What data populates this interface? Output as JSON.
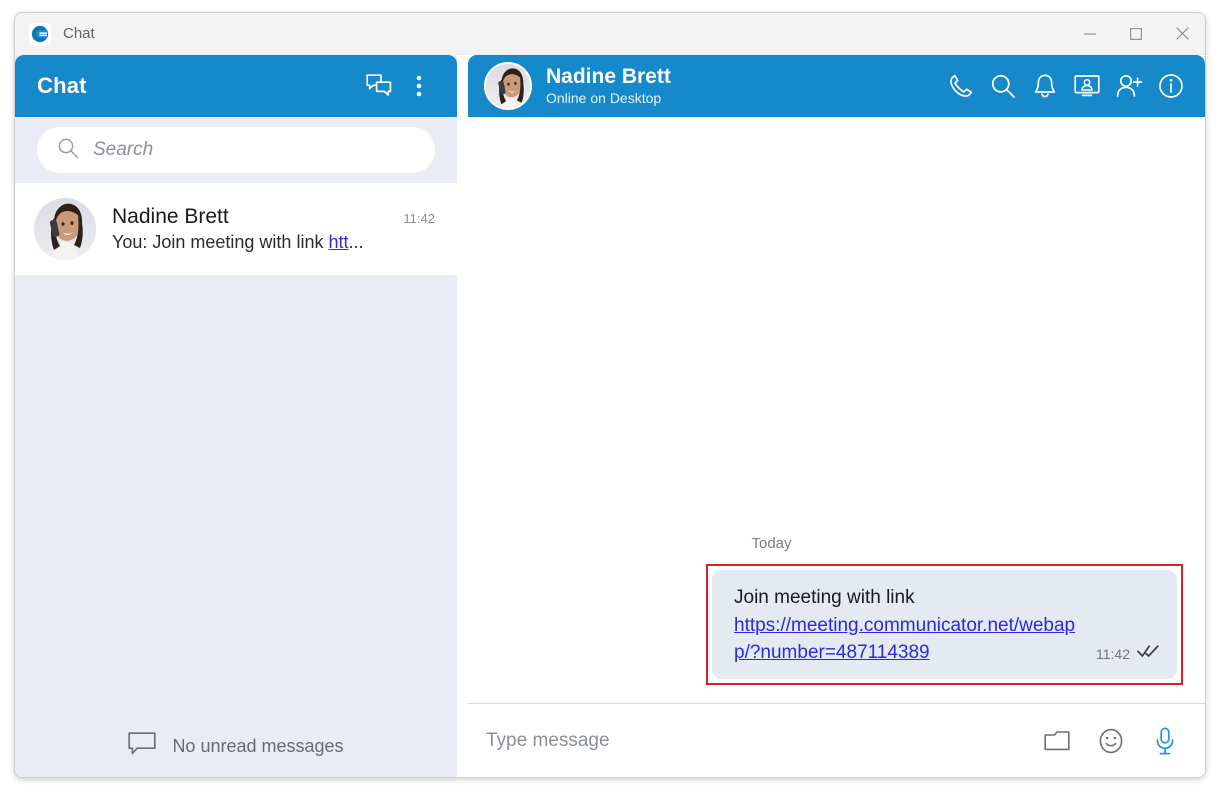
{
  "window": {
    "app_title": "Chat",
    "app_icon": "communicator-logo-icon",
    "controls": {
      "minimize": "minimize-icon",
      "maximize": "maximize-icon",
      "close": "close-icon"
    }
  },
  "sidebar": {
    "title": "Chat",
    "header_actions": [
      {
        "name": "new-chat-icon",
        "label": "New chat"
      },
      {
        "name": "more-options-icon",
        "label": "More options"
      }
    ],
    "search": {
      "placeholder": "Search",
      "icon": "search-icon"
    },
    "conversations": [
      {
        "name": "Nadine Brett",
        "time": "11:42",
        "preview_prefix": "You: Join meeting with link ",
        "preview_link": "htt",
        "preview_suffix": "..."
      }
    ],
    "footer": {
      "icon": "chat-bubble-icon",
      "label": "No unread messages"
    }
  },
  "chat": {
    "peer_name": "Nadine Brett",
    "peer_status": "Online on Desktop",
    "header_actions": [
      {
        "name": "call-icon",
        "label": "Call"
      },
      {
        "name": "search-icon",
        "label": "Search in conversation"
      },
      {
        "name": "bell-icon",
        "label": "Notifications"
      },
      {
        "name": "screen-share-icon",
        "label": "Share screen"
      },
      {
        "name": "add-person-icon",
        "label": "Add participant"
      },
      {
        "name": "info-icon",
        "label": "Contact info"
      }
    ],
    "day_separator": "Today",
    "messages": [
      {
        "text_prefix": "Join meeting with link ",
        "link": "https://meeting.communicator.net/webapp/?number=487114389",
        "time": "11:42",
        "status": "read",
        "outgoing": true,
        "highlighted": true
      }
    ],
    "composer": {
      "placeholder": "Type message",
      "value": "",
      "actions": [
        {
          "name": "attach-file-icon",
          "label": "Attach file"
        },
        {
          "name": "emoji-icon",
          "label": "Emoji"
        },
        {
          "name": "microphone-icon",
          "label": "Voice message"
        }
      ]
    }
  },
  "colors": {
    "accent_blue": "#1689CA",
    "sidebar_bg": "#E9ECF5",
    "bubble_bg": "#E4E9F2",
    "link": "#2A2AE0",
    "highlight_red": "#E02020",
    "mic_blue": "#2196D8"
  }
}
